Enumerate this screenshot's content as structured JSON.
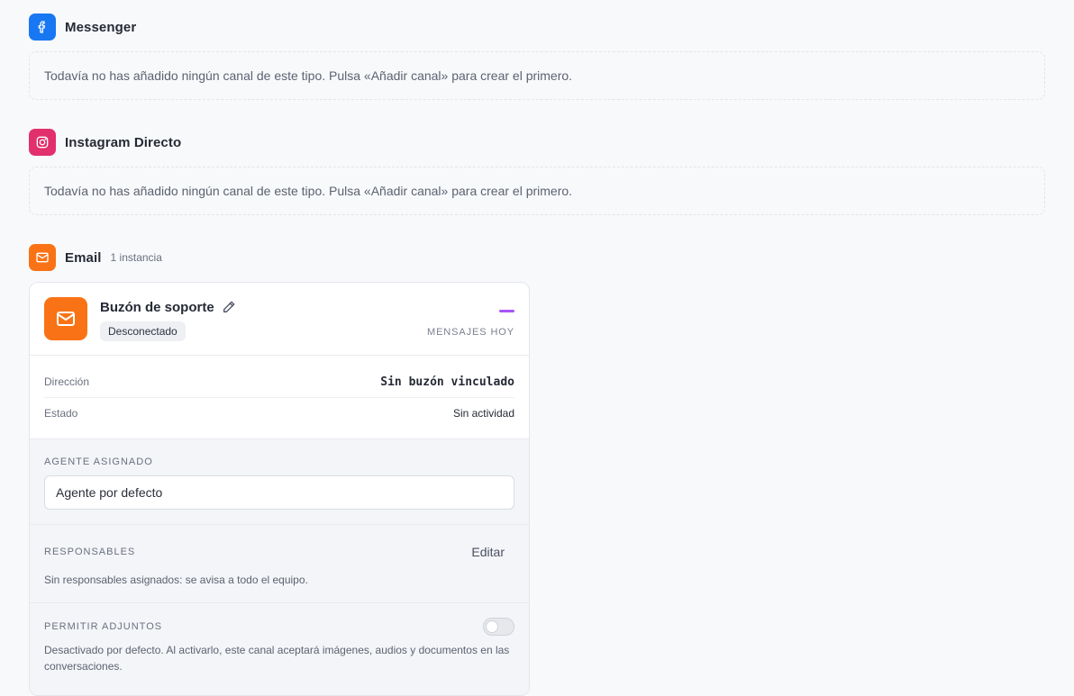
{
  "sections": {
    "messenger": {
      "title": "Messenger",
      "empty_text": "Todavía no has añadido ningún canal de este tipo. Pulsa «Añadir canal» para crear el primero.",
      "icon": "facebook-icon",
      "color": "#1877f2"
    },
    "instagram": {
      "title": "Instagram Directo",
      "empty_text": "Todavía no has añadido ningún canal de este tipo. Pulsa «Añadir canal» para crear el primero.",
      "icon": "instagram-icon",
      "color": "#e1306c"
    },
    "email": {
      "title": "Email",
      "count": "1 instancia",
      "icon": "mail-icon",
      "color": "#f97316"
    }
  },
  "card": {
    "name": "Buzón de soporte",
    "status_badge": "Desconectado",
    "messages_label": "Mensajes hoy",
    "info": [
      {
        "label": "Dirección",
        "value": "Sin buzón vinculado"
      },
      {
        "label": "Estado",
        "value": "Sin actividad"
      }
    ],
    "agent": {
      "label": "Agente asignado",
      "selected": "Agente por defecto"
    },
    "responsibles": {
      "label": "Responsables",
      "edit_label": "Editar",
      "note": "Sin responsables asignados: se avisa a todo el equipo."
    },
    "attachments": {
      "label": "Permitir adjuntos",
      "enabled": false,
      "note": "Desactivado por defecto. Al activarlo, este canal aceptará imágenes, audios y documentos en las conversaciones."
    }
  }
}
